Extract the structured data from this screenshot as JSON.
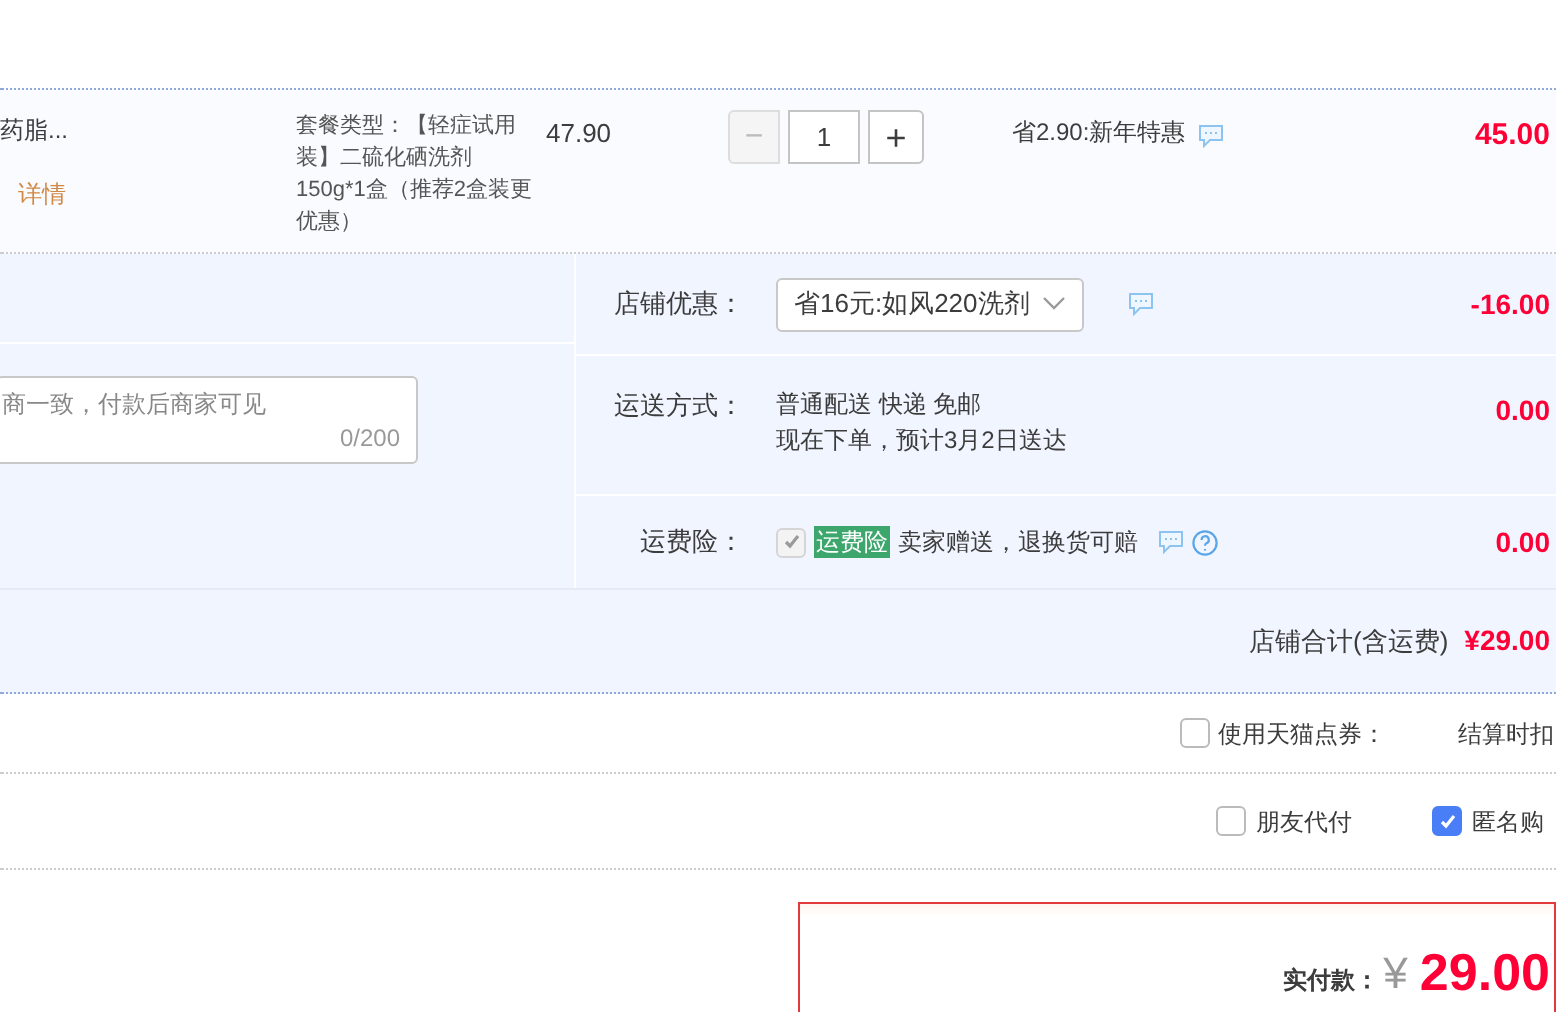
{
  "item": {
    "title": "药脂...",
    "detail_link": "详情",
    "spec": "套餐类型：【轻症试用装】二硫化硒洗剂150g*1盒（推荐2盒装更优惠）",
    "price": "47.90",
    "quantity": "1",
    "minus": "−",
    "plus": "+",
    "promotion": "省2.90:新年特惠",
    "subtotal": "45.00"
  },
  "message": {
    "placeholder": "商一致，付款后商家可见",
    "counter": "0/200"
  },
  "options": [
    {
      "kind": "select",
      "label": "店铺优惠：",
      "value": "省16元:如风220洗剂",
      "amount": "-16.00"
    },
    {
      "kind": "shipping",
      "label": "运送方式：",
      "lines": [
        "普通配送 快递 免邮",
        "现在下单，预计3月2日送达"
      ],
      "amount": "0.00"
    },
    {
      "kind": "insurance",
      "label": "运费险：",
      "checked": true,
      "disabled": true,
      "tag": "运费险",
      "text": "卖家赠送，退换货可赔",
      "amount": "0.00"
    }
  ],
  "store_total": {
    "label": "店铺合计(含运费)",
    "value": "¥29.00"
  },
  "coupon": {
    "label": "使用天猫点券：",
    "checked": false,
    "note": "结算时扣"
  },
  "payment_options": [
    {
      "label": "朋友代付",
      "checked": false
    },
    {
      "label": "匿名购",
      "checked": true
    }
  ],
  "summary": {
    "label": "实付款：",
    "currency": "¥",
    "value": "29.00"
  }
}
